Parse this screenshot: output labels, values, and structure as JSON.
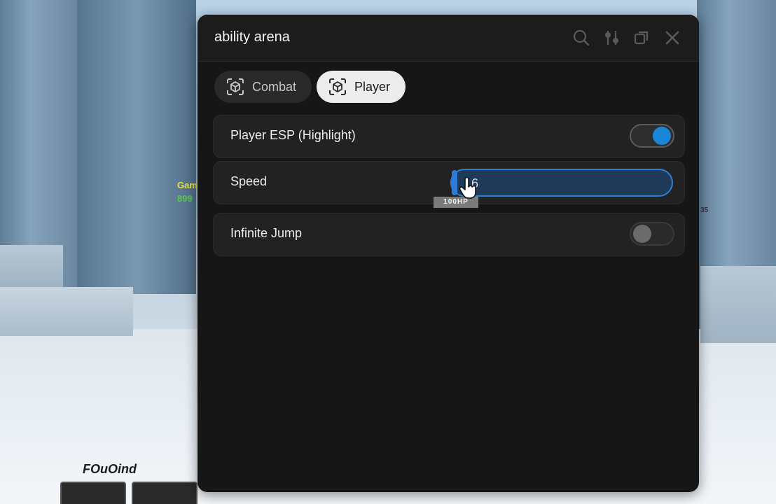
{
  "window": {
    "title": "ability arena"
  },
  "titlebar_icons": [
    "search-icon",
    "settings-icon",
    "minimize-icon",
    "close-icon"
  ],
  "tabs": [
    {
      "label": "Combat",
      "icon": "cube-scan-icon",
      "active": false
    },
    {
      "label": "Player",
      "icon": "cube-scan-icon",
      "active": true
    }
  ],
  "features": {
    "player_esp": {
      "label": "Player ESP (Highlight)",
      "enabled": true
    },
    "speed": {
      "label": "Speed",
      "value": "16"
    },
    "infinite_jump": {
      "label": "Infinite Jump",
      "enabled": false
    }
  },
  "game_overlay": {
    "hp_label": "100HP",
    "player_name_fragment": "Gam",
    "player_hp_fragment": "899",
    "corner_name": "FOuOind",
    "right_number": "35"
  },
  "colors": {
    "accent": "#1a86d8",
    "window_bg": "#161616",
    "row_bg": "#222222"
  }
}
